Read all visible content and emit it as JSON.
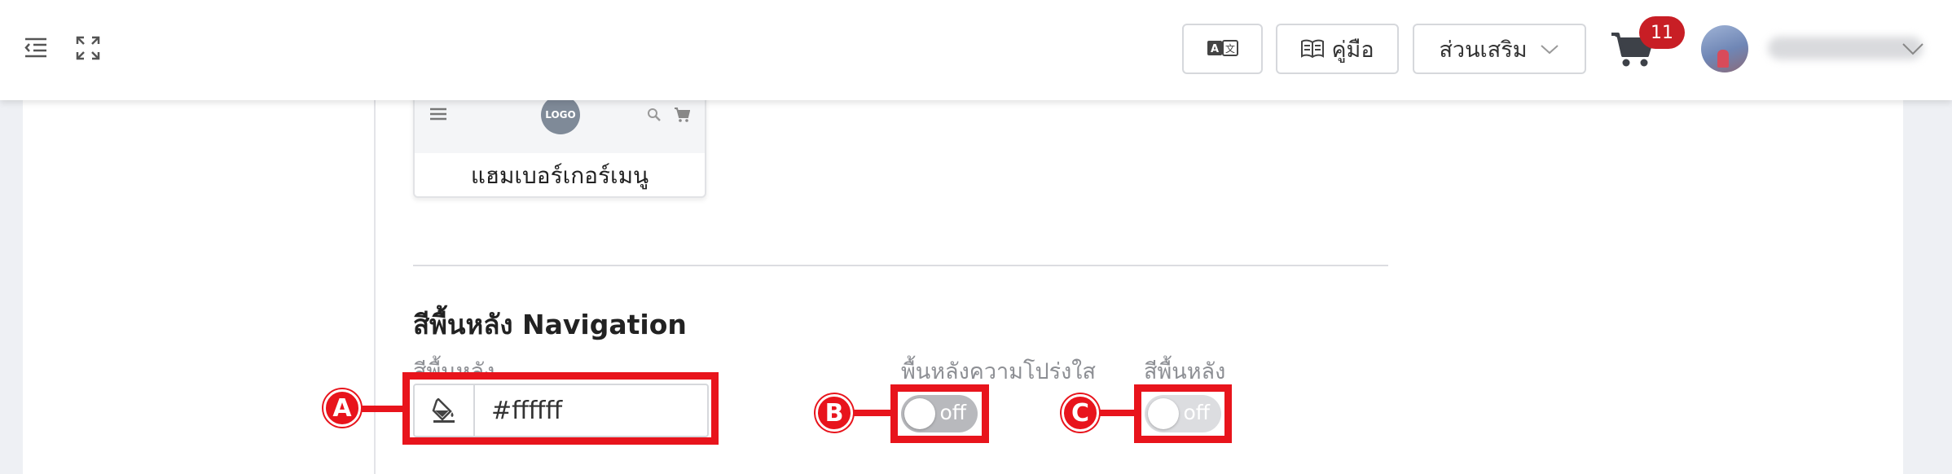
{
  "header": {
    "translate_icon": "translate-icon",
    "manual_label": "คู่มือ",
    "addons_label": "ส่วนเสริม",
    "cart_count": "11"
  },
  "preview": {
    "logo_text": "LOGO",
    "caption": "แฮมเบอร์เกอร์เมนู"
  },
  "section": {
    "title": "สีพื้นหลัง Navigation",
    "bg_color_label": "สีพื้นหลัง",
    "bg_color_value": "#ffffff",
    "transparency_label": "พื้นหลังความโปร่งใส",
    "transparency_state": "off",
    "bg_toggle_label": "สีพื้นหลัง",
    "bg_toggle_state": "off"
  },
  "annotations": {
    "a": "A",
    "b": "B",
    "c": "C",
    "color": "#e8141c"
  }
}
